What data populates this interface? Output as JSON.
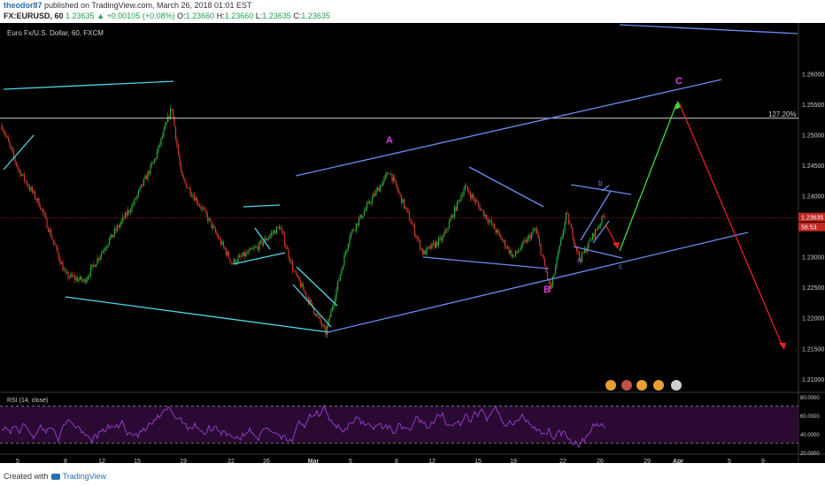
{
  "header": {
    "username": "theodor87",
    "published_text": "published on TradingView.com, March 26, 2018 01:01 EST",
    "symbol": "FX:EURUSD, 60",
    "last": "1.23635",
    "change_arrow": "▲",
    "change": "+0.00105 (+0.08%)",
    "open_label": "O:",
    "open": "1.23660",
    "high_label": "H:",
    "high": "1.23660",
    "low_label": "L:",
    "low": "1.23635",
    "close_label": "C:",
    "close": "1.23635"
  },
  "footer": {
    "created_with": "Created with",
    "brand": "TradingView"
  },
  "chart_data": {
    "type": "candlestick",
    "title": "Euro Fx/U.S. Dollar, 60, FXCM",
    "y_ticks": [
      "1.26000",
      "1.25500",
      "1.25000",
      "1.24500",
      "1.24000",
      "1.23500",
      "1.23000",
      "1.22500",
      "1.22000",
      "1.21500",
      "1.21000"
    ],
    "ylim": [
      1.2078,
      1.2683
    ],
    "x_ticks": [
      "5",
      "8",
      "12",
      "15",
      "19",
      "22",
      "26",
      "Mar",
      "5",
      "8",
      "12",
      "15",
      "19",
      "22",
      "26",
      "29",
      "Apr",
      "5",
      "9"
    ],
    "last_price_label": "1.23635",
    "countdown_label": "58:53",
    "fib_label": "127.20%",
    "fib_level": 1.2527,
    "current_price_level": 1.23635,
    "wave_labels": [
      "A",
      "B",
      "C",
      "a",
      "b",
      "c"
    ],
    "rsi": {
      "label": "RSI (14, close)",
      "ticks": [
        "80.0000",
        "60.0000",
        "40.0000",
        "20.0000"
      ],
      "overbought": 70,
      "oversold": 30
    },
    "colors": {
      "background": "#000000",
      "bull_candle": "#2fae3b",
      "bear_candle": "#d43a2a",
      "cyan_lines": "#4fd8e6",
      "blue_lines": "#6a8df0",
      "wave_labels": "#e040e0",
      "green_arrow": "#3ddc3d",
      "red_arrow": "#e82020",
      "rsi_line": "#9a3fd0",
      "rsi_band": "#2a0a33"
    }
  }
}
